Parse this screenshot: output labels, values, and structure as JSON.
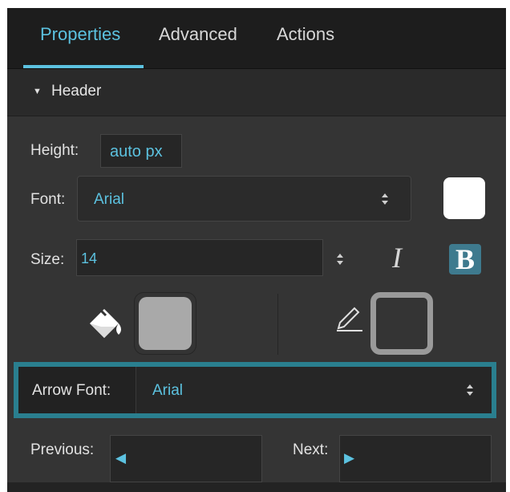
{
  "tabs": [
    {
      "label": "Properties",
      "active": true
    },
    {
      "label": "Advanced",
      "active": false
    },
    {
      "label": "Actions",
      "active": false
    }
  ],
  "section": {
    "title": "Header",
    "expanded": true
  },
  "height": {
    "label": "Height:",
    "value": "auto px"
  },
  "font": {
    "label": "Font:",
    "value": "Arial"
  },
  "font_color": "#ffffff",
  "size": {
    "label": "Size:",
    "value": "14"
  },
  "style_buttons": {
    "italic": "I",
    "bold": "B",
    "bold_active": true
  },
  "fill_color": "#a9a9a9",
  "border_color": "#9a9a9a",
  "arrow_font": {
    "label": "Arrow Font:",
    "value": "Arial"
  },
  "previous": {
    "label": "Previous:",
    "glyph": "◀"
  },
  "next": {
    "label": "Next:",
    "glyph": "▶"
  },
  "colors": {
    "accent": "#5cc2e0",
    "highlight": "#2a7f8f",
    "panel": "#343434"
  },
  "icons": [
    "fill-bucket-icon",
    "pencil-icon",
    "disclosure-triangle-icon"
  ]
}
